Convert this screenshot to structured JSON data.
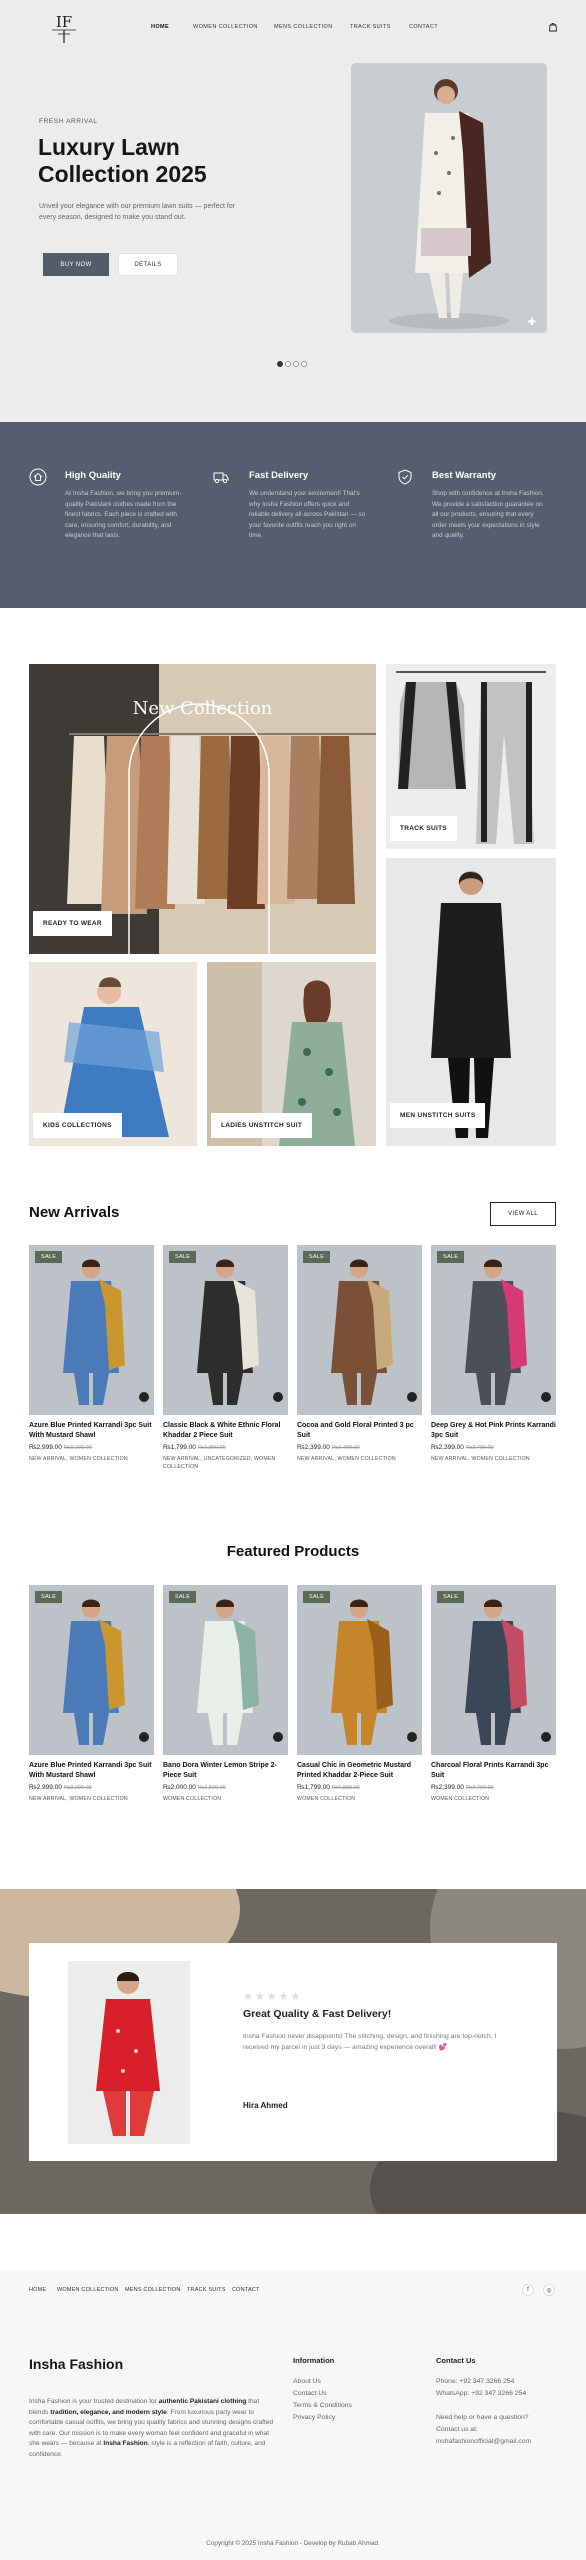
{
  "nav": {
    "links": [
      "HOME",
      "WOMEN COLLECTION",
      "MENS COLLECTION",
      "TRACK SUITS",
      "CONTACT"
    ]
  },
  "hero": {
    "eyebrow": "FRESH ARRIVAL",
    "title": "Luxury Lawn Collection 2025",
    "subtitle": "Unveil your elegance with our premium lawn suits — perfect for every season, designed to make you stand out.",
    "buy_label": "BUY NOW",
    "details_label": "DETAILS",
    "carousel_dots": 4,
    "active_dot": 0
  },
  "features": [
    {
      "icon": "home-icon",
      "title": "High Quality",
      "text": "At Insha Fashion, we bring you premium-quality Pakistani clothes made from the finest fabrics. Each piece is crafted with care, ensuring comfort, durability, and elegance that lasts."
    },
    {
      "icon": "truck-icon",
      "title": "Fast Delivery",
      "text": "We understand your excitement! That's why Insha Fashion offers quick and reliable delivery all across Pakistan — so your favorite outfits reach you right on time."
    },
    {
      "icon": "shield-icon",
      "title": "Best Warranty",
      "text": "Shop with confidence at Insha Fashion. We provide a satisfaction guarantee on all our products, ensuring that every order meets your expectations in style and quality."
    }
  ],
  "collections": {
    "title": "New Collection",
    "items": [
      "READY TO WEAR",
      "TRACK SUITS",
      "KIDS COLLECTIONS",
      "LADIES UNSTITCH SUIT",
      "MEN UNSTITCH SUITS"
    ]
  },
  "new_arrivals": {
    "title": "New Arrivals",
    "view_all": "VIEW ALL",
    "sale_label": "SALE",
    "products": [
      {
        "name": "Azure Blue Printed Karrandi 3pc Suit With Mustard Shawl",
        "price": "₨2,999.00",
        "old": "₨3,299.00",
        "cats": "NEW ARRIVAL, WOMEN COLLECTION"
      },
      {
        "name": "Classic Black & White Ethnic Floral Khaddar 2 Piece Suit",
        "price": "₨1,799.00",
        "old": "₨1,899.00",
        "cats": "NEW ARRIVAL, UNCATEGORIZED, WOMEN COLLECTION"
      },
      {
        "name": "Cocoa and Gold Floral Printed 3 pc Suit",
        "price": "₨2,399.00",
        "old": "₨2,799.00",
        "cats": "NEW ARRIVAL, WOMEN COLLECTION"
      },
      {
        "name": "Deep Grey & Hot Pink Prints Karrandi 3pc Suit",
        "price": "₨2,399.00",
        "old": "₨2,799.00",
        "cats": "NEW ARRIVAL, WOMEN COLLECTION"
      }
    ]
  },
  "featured": {
    "title": "Featured Products",
    "sale_label": "SALE",
    "products": [
      {
        "name": "Azure Blue Printed Karrandi 3pc Suit With Mustard Shawl",
        "price": "₨2,999.00",
        "old": "₨3,299.00",
        "cats": "NEW ARRIVAL, WOMEN COLLECTION"
      },
      {
        "name": "Bano Dora Winter Lemon Stripe 2-Piece Suit",
        "price": "₨2,000.00",
        "old": "₨2,500.00",
        "cats": "WOMEN COLLECTION"
      },
      {
        "name": "Casual Chic in Geometric Mustard Printed Khaddar 2-Piece Suit",
        "price": "₨1,799.00",
        "old": "₨1,899.00",
        "cats": "WOMEN COLLECTION"
      },
      {
        "name": "Charcoal Floral Prints Karrandi 3pc Suit",
        "price": "₨2,399.00",
        "old": "₨2,799.00",
        "cats": "WOMEN COLLECTION"
      }
    ]
  },
  "testimonial": {
    "stars": "★★★★★",
    "title": "Great Quality & Fast Delivery!",
    "text": "Insha Fashion never disappoints! The stitching, design, and finishing are top-notch. I received my parcel in just 3 days — amazing experience overall! 💕",
    "author": "Hira Ahmed"
  },
  "footer": {
    "nav": [
      "HOME",
      "WOMEN COLLECTION",
      "MENS COLLECTION",
      "TRACK SUITS",
      "CONTACT"
    ],
    "brand": "Insha Fashion",
    "about_1": "Insha Fashion is your trusted destination for ",
    "about_b1": "authentic Pakistani clothing",
    "about_2": " that blends ",
    "about_b2": "tradition, elegance, and modern style",
    "about_3": ". From luxurious party wear to comfortable casual outfits, we bring you quality fabrics and stunning designs crafted with care. Our mission is to make every woman feel confident and graceful in what she wears — because at ",
    "about_b3": "Insha Fashion",
    "about_4": ", style is a reflection of faith, culture, and confidence.",
    "info_title": "Information",
    "info_links": [
      "About Us",
      "Contact Us",
      "Terms & Conditions",
      "Privacy Policy"
    ],
    "contact_title": "Contact Us",
    "contact_lines": [
      "Phone: +92 347 3266 254",
      "WhatsApp: +92 347 3266 254",
      "",
      "Need help or have a question?",
      "Contact us at:",
      "inshafashionofficial@gmail.com"
    ],
    "copyright": "Copyright © 2025 Insha Fashion - Develop by Rubab Ahmad."
  },
  "colors": {
    "band": "#555e6e",
    "button": "#545c6b",
    "sale": "#5a6a55",
    "accent": "#111111"
  }
}
